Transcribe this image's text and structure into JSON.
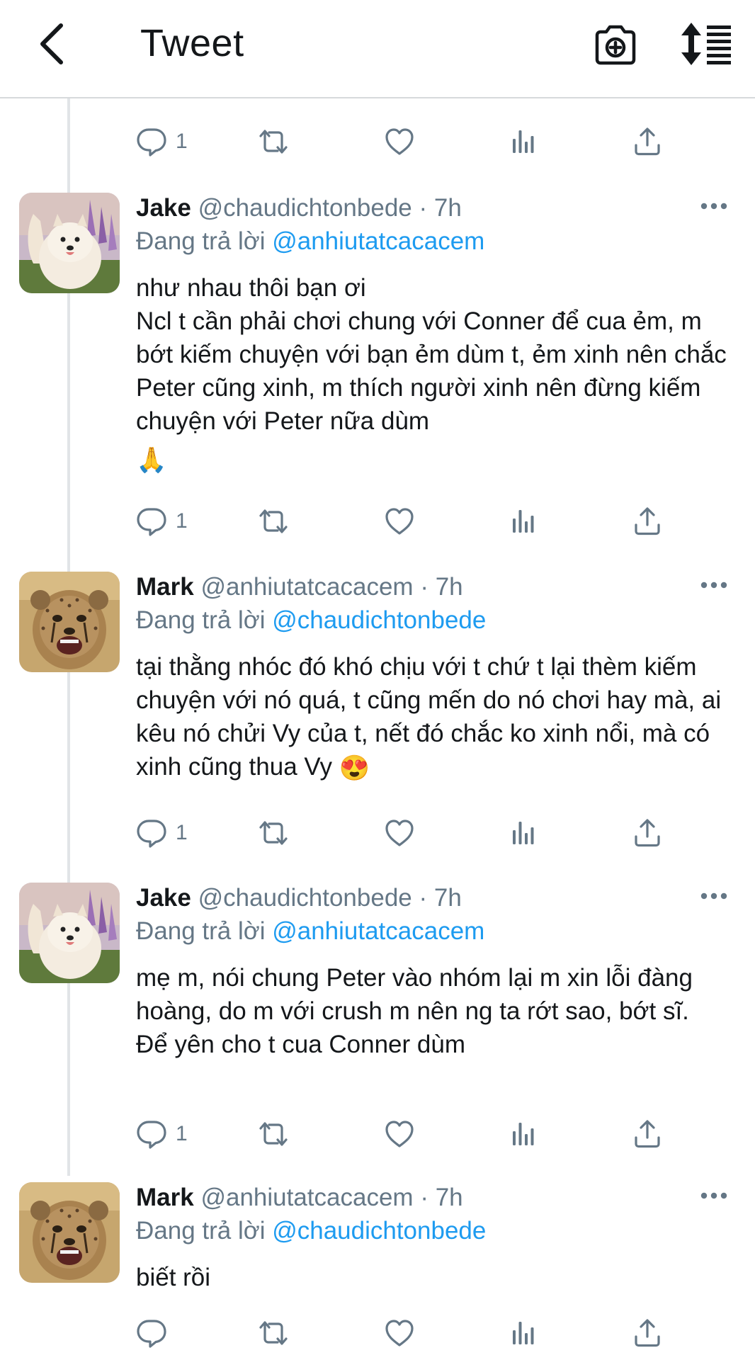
{
  "header": {
    "title": "Tweet",
    "back_icon": "chevron-left-icon",
    "camera_icon": "camera-plus-icon",
    "sort_icon": "sort-lines-icon"
  },
  "colors": {
    "link": "#1d9bf0",
    "secondary": "#657786",
    "text": "#14171a",
    "divider": "#d6d9db"
  },
  "top_actions": {
    "reply_count": "1"
  },
  "tweets": [
    {
      "name": "Jake",
      "handle": "@chaudichtonbede",
      "sep": "·",
      "time": "7h",
      "replying_prefix": "Đang trả lời",
      "replying_to": "@anhiutatcacacem",
      "lines": [
        "như nhau thôi bạn ơi",
        "Ncl t cần phải chơi chung với Conner để cua ẻm, m bớt kiếm chuyện với bạn ẻm dùm t, ẻm xinh nên chắc Peter cũng xinh, m thích người xinh nên đừng kiếm chuyện với Peter nữa dùm"
      ],
      "trailing_emoji": "🙏",
      "reply_count": "1",
      "avatar": "samoyed-dog-avatar"
    },
    {
      "name": "Mark",
      "handle": "@anhiutatcacacem",
      "sep": "·",
      "time": "7h",
      "replying_prefix": "Đang trả lời",
      "replying_to": "@chaudichtonbede",
      "lines": [
        "tại thằng nhóc đó khó chịu với t chứ t lại thèm kiếm chuyện với nó quá, t cũng mến do nó chơi hay mà, ai kêu nó chửi Vy của t, nết đó chắc ko xinh nổi, mà có xinh cũng thua Vy"
      ],
      "trailing_emoji": "😍",
      "reply_count": "1",
      "avatar": "cheetah-cub-avatar"
    },
    {
      "name": "Jake",
      "handle": "@chaudichtonbede",
      "sep": "·",
      "time": "7h",
      "replying_prefix": "Đang trả lời",
      "replying_to": "@anhiutatcacacem",
      "lines": [
        "mẹ m, nói chung Peter vào nhóm lại m xin lỗi đàng hoàng, do m với crush m nên ng ta rớt sao, bớt sĩ.",
        "Để yên cho t cua Conner dùm"
      ],
      "reply_count": "1",
      "avatar": "samoyed-dog-avatar"
    },
    {
      "name": "Mark",
      "handle": "@anhiutatcacacem",
      "sep": "·",
      "time": "7h",
      "replying_prefix": "Đang trả lời",
      "replying_to": "@chaudichtonbede",
      "lines": [
        "biết rồi"
      ],
      "reply_count": "",
      "avatar": "cheetah-cub-avatar"
    }
  ]
}
